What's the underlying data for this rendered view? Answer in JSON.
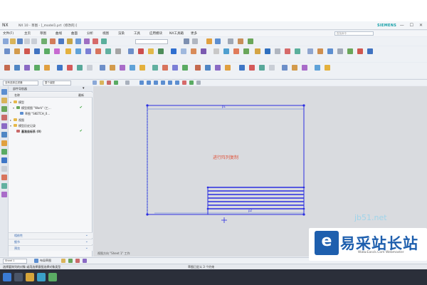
{
  "window": {
    "app_logo": "NX",
    "title": "NX 10 - 草图 - [_model1.prt（修改的）]",
    "brand": "SIEMENS",
    "window_controls": "— ☐ ✕"
  },
  "menu": {
    "items": [
      "文件(F)",
      "主页",
      "草图",
      "曲线",
      "曲面",
      "分析",
      "视图",
      "渲染",
      "工具",
      "应用模块",
      "NX工具箱",
      "更多"
    ],
    "search_placeholder": "查找命令"
  },
  "selection_bar": {
    "filter_value": "没有选择过滤器",
    "scope_value": "整个装配"
  },
  "navigator": {
    "title": "部件导航器",
    "column_name": "名称",
    "column_latest": "最新",
    "tree": [
      {
        "label": "模型",
        "check": ""
      },
      {
        "label": "模型视图 \"Work\" (工...",
        "check": "✔"
      },
      {
        "label": "草图 \"SKETCH_0...",
        "check": ""
      },
      {
        "label": "视图",
        "check": ""
      },
      {
        "label": "模型历史记录",
        "check": ""
      },
      {
        "label": "基准坐标系 (0)",
        "check": "✔"
      }
    ],
    "sections": [
      "相依性",
      "细节",
      "预览"
    ]
  },
  "graphics": {
    "annotation": "进行阵列复制",
    "dimension_top": "p1",
    "dimension_bottom": "p2",
    "caption": "视图方向 \"Sheet 1\" 工作"
  },
  "cue_bar": {
    "sheet_value": "Sheet 1",
    "items": [
      "布局草图"
    ]
  },
  "status": {
    "left": "选择要阵列的对象 或用选择意图选择对象类型",
    "right": "草图已定义 3 个约束"
  },
  "watermark": {
    "url": "jb51.net",
    "logo_letter": "e",
    "name": "易采站长站",
    "sub": "Www.Easck.Com Webmaster"
  },
  "colors": {
    "sketch_blue": "#2b2ee0",
    "annotation_red": "#e0533a",
    "accent": "#1e5fae"
  }
}
